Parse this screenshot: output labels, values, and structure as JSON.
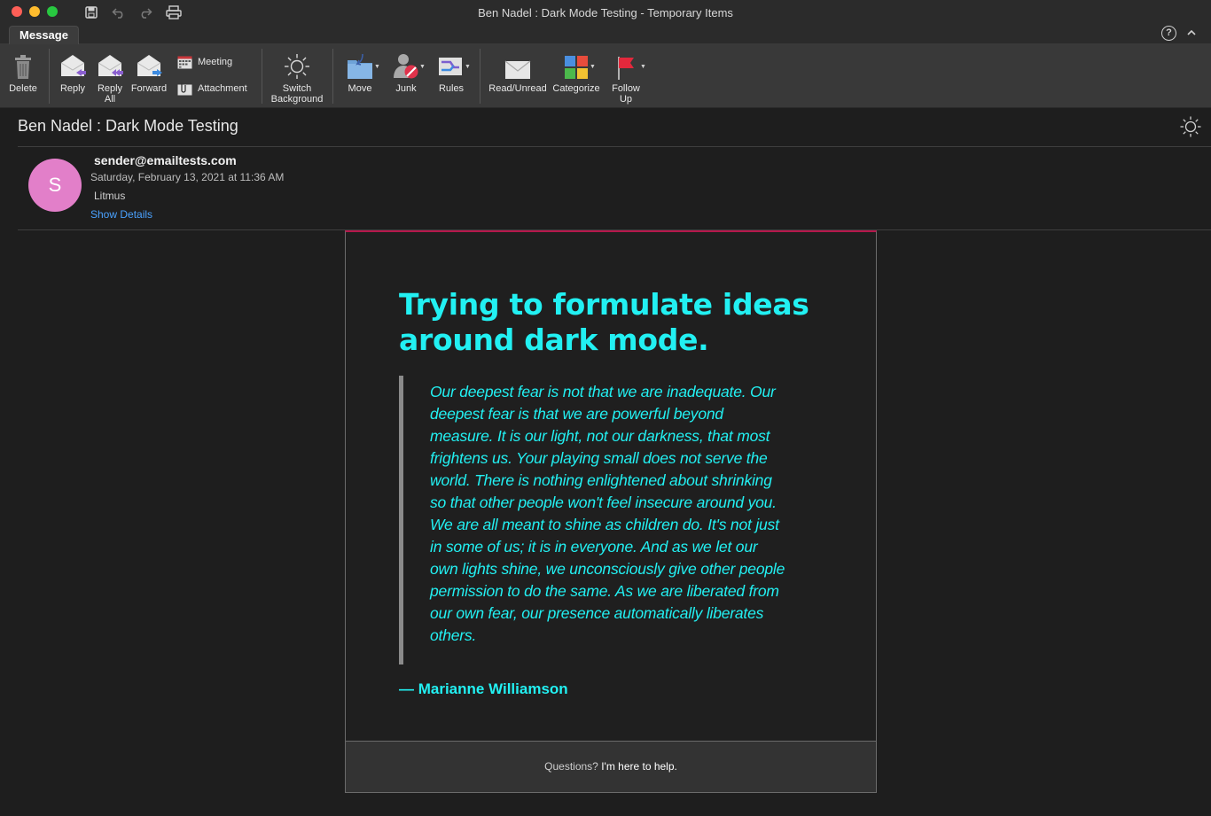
{
  "window": {
    "title": "Ben Nadel : Dark Mode Testing - Temporary Items"
  },
  "tabs": [
    {
      "label": "Message",
      "active": true
    }
  ],
  "ribbon": {
    "delete": "Delete",
    "reply": "Reply",
    "reply_all_1": "Reply",
    "reply_all_2": "All",
    "forward": "Forward",
    "meeting": "Meeting",
    "attachment": "Attachment",
    "switch_bg_1": "Switch",
    "switch_bg_2": "Background",
    "move": "Move",
    "junk": "Junk",
    "rules": "Rules",
    "read_unread": "Read/Unread",
    "categorize": "Categorize",
    "follow_up_1": "Follow",
    "follow_up_2": "Up"
  },
  "message": {
    "subject": "Ben Nadel : Dark Mode Testing",
    "avatar_initial": "S",
    "sender": "sender@emailtests.com",
    "date": "Saturday, February 13, 2021 at 11:36 AM",
    "recipient": "Litmus",
    "show_details": "Show Details"
  },
  "email": {
    "headline": "Trying to formulate ideas around dark mode.",
    "quote_lines": [
      "Our deepest fear is not that we are inadequate. Our",
      "deepest fear is that we are powerful beyond",
      "measure. It is our light, not our darkness, that most",
      "frightens us. Your playing small does not serve the",
      "world. There is nothing enlightened about shrinking",
      "so that other people won't feel insecure around you.",
      "We are all meant to shine as children do. It's not just",
      "in some of us; it is in everyone. And as we let our",
      "own lights shine, we unconsciously give other people",
      "permission to do the same. As we are liberated from",
      "our own fear, our presence automatically liberates",
      "others."
    ],
    "attribution": "— Marianne Williamson",
    "footer_question": "Questions?",
    "footer_link": "I'm here to help."
  },
  "colors": {
    "accent_cyan": "#22f0f2",
    "avatar": "#e27fc9",
    "link": "#4aa2ff",
    "card_top_border": "#b5174b"
  }
}
